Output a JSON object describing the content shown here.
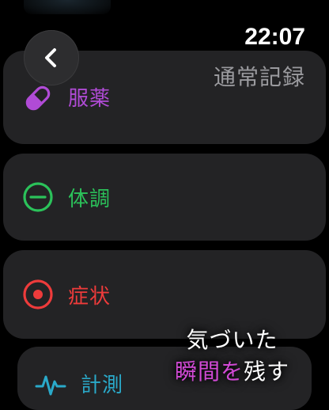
{
  "status": {
    "time": "22:07"
  },
  "header": {
    "subtitle": "通常記録"
  },
  "colors": {
    "medication": "#b04bd6",
    "condition": "#2bc25a",
    "symptom": "#ee3b3b",
    "measure": "#2aa9c9",
    "tagline_accent": "#d24ad6"
  },
  "menu": {
    "medication": {
      "label": "服薬",
      "icon": "pill-icon"
    },
    "condition": {
      "label": "体調",
      "icon": "minus-circle-icon"
    },
    "symptom": {
      "label": "症状",
      "icon": "dot-circle-icon"
    },
    "measure": {
      "label": "計測",
      "icon": "pulse-icon"
    }
  },
  "tagline": {
    "line1": "気づいた",
    "line2_accent": "瞬間を",
    "line2_rest": "残す"
  }
}
